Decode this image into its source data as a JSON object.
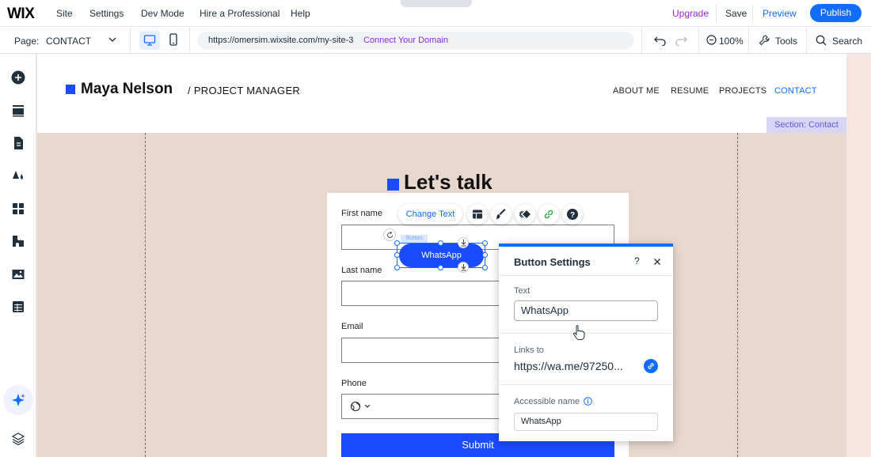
{
  "topbar": {
    "logo": "WIX",
    "menu": [
      "Site",
      "Settings",
      "Dev Mode",
      "Hire a Professional",
      "Help"
    ],
    "upgrade": "Upgrade",
    "save": "Save",
    "preview": "Preview",
    "publish": "Publish",
    "handle_glyph": "⌃"
  },
  "secondbar": {
    "page_label": "Page:",
    "page_value": "CONTACT",
    "url": "https://omersim.wixsite.com/my-site-3",
    "connect_domain": "Connect Your Domain",
    "zoom": "100%",
    "tools": "Tools",
    "search": "Search"
  },
  "site": {
    "brand_name": "Maya Nelson",
    "brand_title": "/ PROJECT MANAGER",
    "nav": [
      "ABOUT ME",
      "RESUME",
      "PROJECTS",
      "CONTACT"
    ],
    "active_nav": "CONTACT",
    "section_label": "Section: Contact",
    "heading": "Let's talk",
    "form": {
      "labels": [
        "First name",
        "Last name",
        "Email",
        "Phone"
      ],
      "submit": "Submit"
    }
  },
  "toolbar": {
    "change_text": "Change Text",
    "icons": [
      "layout-icon",
      "design-icon",
      "animation-icon",
      "link-icon",
      "help-icon"
    ]
  },
  "selected_button": {
    "label": "WhatsApp",
    "tag": "Button"
  },
  "settings_panel": {
    "title": "Button Settings",
    "help": "?",
    "text_label": "Text",
    "text_value": "WhatsApp",
    "links_label": "Links to",
    "links_value": "https://wa.me/97250...",
    "accessible_label": "Accessible name",
    "accessible_value": "WhatsApp"
  },
  "colors": {
    "accent": "#116dff",
    "brand_blue": "#1a4bff",
    "section_bg": "#e8d7cd",
    "upgrade": "#9a27d5"
  }
}
